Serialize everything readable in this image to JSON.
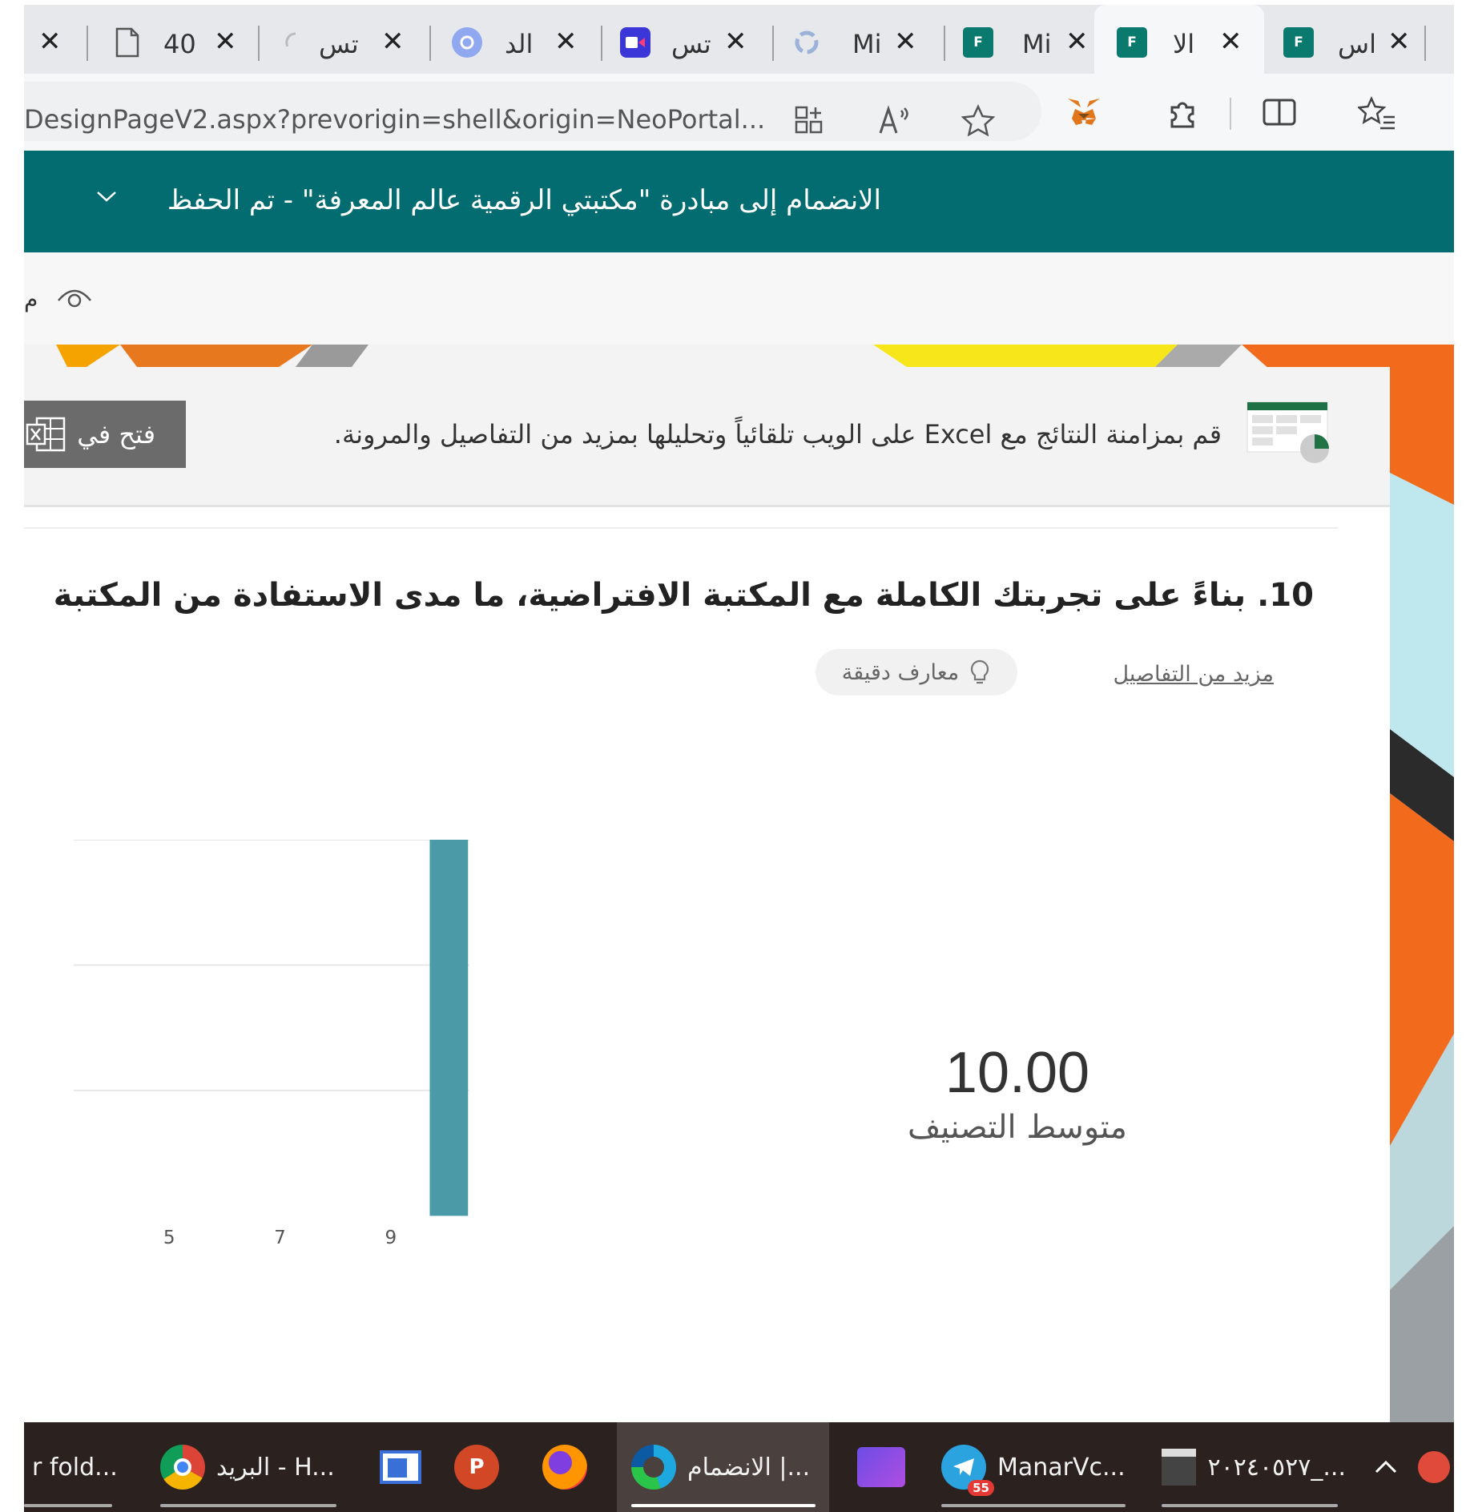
{
  "browser": {
    "tabs": [
      {
        "title": "",
        "icon": "close-only"
      },
      {
        "title": "40",
        "icon": "document-icon"
      },
      {
        "title": "تس",
        "icon": "loading-icon"
      },
      {
        "title": "الد",
        "icon": "copilot-icon"
      },
      {
        "title": "تس",
        "icon": "video-icon"
      },
      {
        "title": "Mi",
        "icon": "sync-icon"
      },
      {
        "title": "Mi",
        "icon": "forms-icon"
      },
      {
        "title": "الا",
        "icon": "forms-icon",
        "active": true
      },
      {
        "title": "اس",
        "icon": "forms-icon"
      }
    ],
    "close_glyph": "✕",
    "url": "DesignPageV2.aspx?prevorigin=shell&origin=NeoPortal..."
  },
  "forms_header": {
    "title": "الانضمام إلى مبادرة \"مكتبتي الرقمية عالم المعرفة\" - تم الحفظ",
    "color": "#036c70"
  },
  "subbar": {
    "preview_partial": "م"
  },
  "banner": {
    "text": "قم بمزامنة النتائج مع Excel على الويب تلقائياً وتحليلها بمزيد من التفاصيل والمرونة.",
    "button_label": "فتح في"
  },
  "question": {
    "text": "10. بناءً على تجربتك الكاملة مع المكتبة الافتراضية، ما مدى الاستفادة من المكتبة",
    "more_details": "مزيد من التفاصيل",
    "insights": "معارف دقيقة"
  },
  "average": {
    "value": "10.00",
    "label": "متوسط التصنيف"
  },
  "chart_data": {
    "type": "bar",
    "x_tick_labels": [
      "5",
      "7",
      "9"
    ],
    "bars": [
      {
        "x": 10,
        "count": 1
      }
    ],
    "ylim": [
      0,
      1
    ],
    "grid": true,
    "bar_color": "#4a9aa8"
  },
  "taskbar": {
    "items": [
      {
        "label": "r fold...",
        "icon": "folder-icon"
      },
      {
        "label": "البريد - H...",
        "icon": "chrome-icon"
      },
      {
        "label": "",
        "icon": "app-window-icon"
      },
      {
        "label": "",
        "icon": "powerpoint-icon"
      },
      {
        "label": "",
        "icon": "firefox-icon"
      },
      {
        "label": "الانضمام |...",
        "icon": "edge-icon",
        "active": true
      },
      {
        "label": "",
        "icon": "video-editor-icon"
      },
      {
        "label": "ManarVc...",
        "icon": "telegram-icon",
        "badge": "55"
      },
      {
        "label": "٢٠٢٤٠٥٢٧_...",
        "icon": "clapper-icon"
      }
    ]
  }
}
